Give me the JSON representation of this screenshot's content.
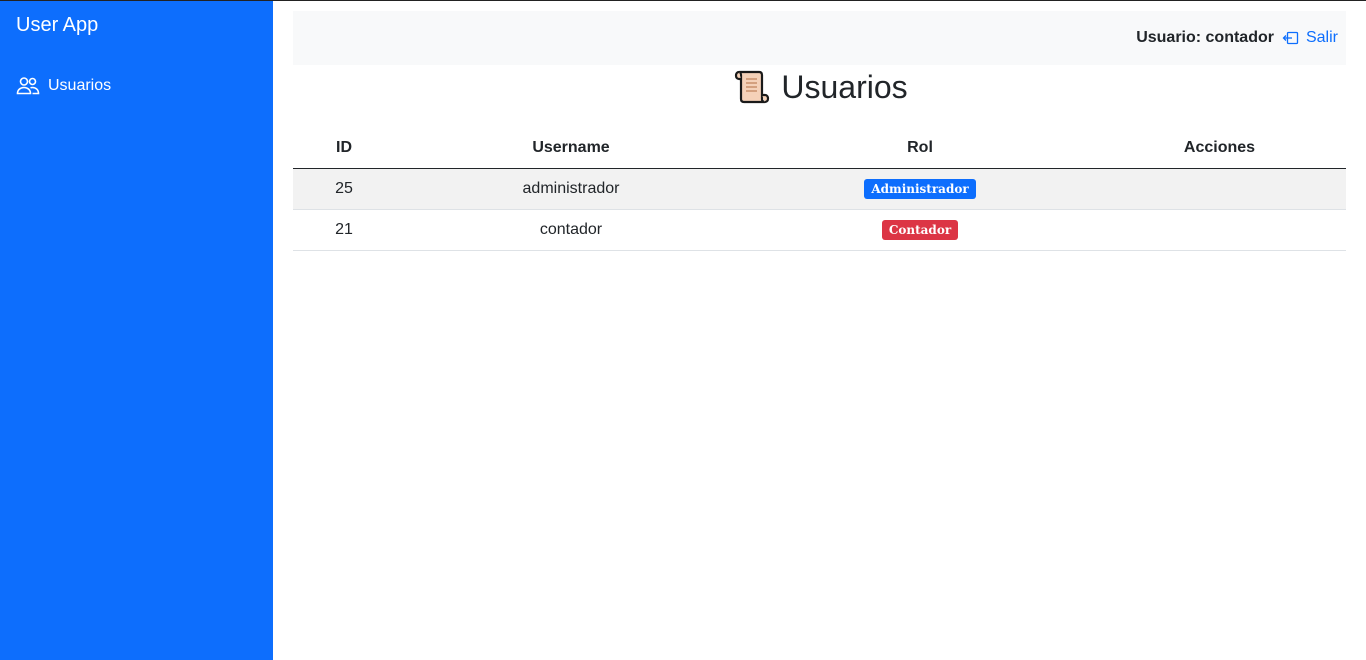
{
  "sidebar": {
    "brand": "User App",
    "items": [
      {
        "label": "Usuarios",
        "icon": "people-icon"
      }
    ]
  },
  "topbar": {
    "user_label": "Usuario: contador",
    "logout_label": "Salir",
    "logout_icon": "box-arrow-left-icon"
  },
  "page": {
    "title": "Usuarios",
    "title_icon": "scroll-icon"
  },
  "table": {
    "headers": [
      "ID",
      "Username",
      "Rol",
      "Acciones"
    ],
    "rows": [
      {
        "id": "25",
        "username": "administrador",
        "rol": "Administrador",
        "rol_color": "#0d6efd"
      },
      {
        "id": "21",
        "username": "contador",
        "rol": "Contador",
        "rol_color": "#dc3545"
      }
    ]
  },
  "colors": {
    "sidebar_bg": "#0d6efd",
    "link": "#0d6efd",
    "danger": "#dc3545"
  }
}
